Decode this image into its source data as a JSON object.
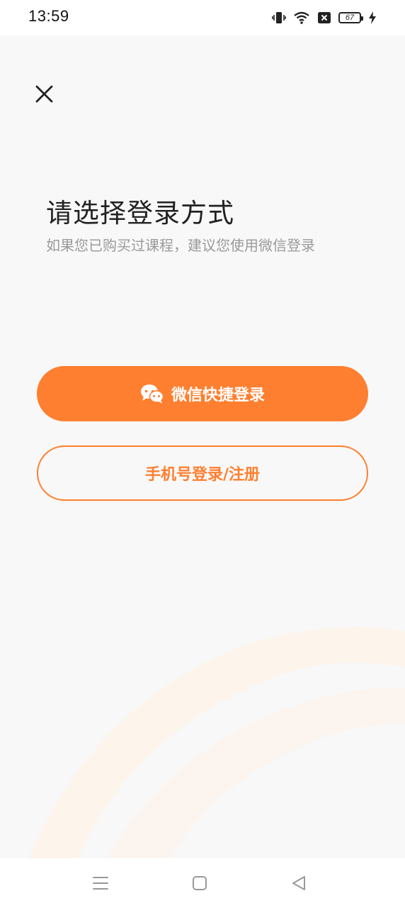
{
  "status_bar": {
    "time": "13:59",
    "battery_level": "67",
    "icons": [
      "vibrate-icon",
      "wifi-icon",
      "no-sim-icon",
      "battery-icon",
      "charging-icon"
    ]
  },
  "header": {
    "close_icon": "close-icon"
  },
  "main": {
    "title": "请选择登录方式",
    "subtitle": "如果您已购买过课程，建议您使用微信登录",
    "wechat_button_label": "微信快捷登录",
    "phone_button_label": "手机号登录/注册"
  },
  "nav_bar": {
    "buttons": [
      "menu-icon",
      "home-icon",
      "back-icon"
    ]
  },
  "colors": {
    "accent": "#ff7f30",
    "background": "#f8f8f8",
    "title": "#222222",
    "subtitle": "#9a9a9a"
  }
}
